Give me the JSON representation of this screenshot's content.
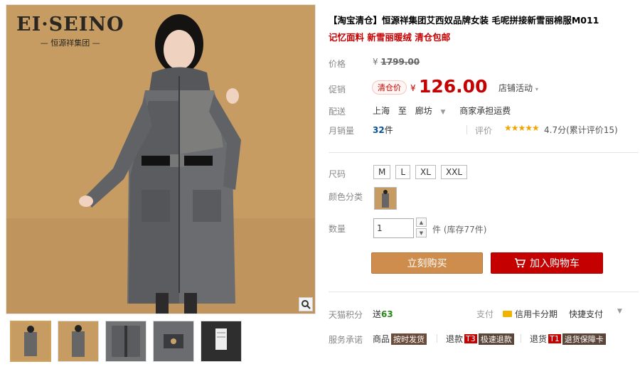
{
  "brand": {
    "name": "EI·SEINO",
    "sub": "— 恒源祥集团 —"
  },
  "title": "【淘宝清仓】恒源祥集团艾西奴品牌女装 毛呢拼接新雪丽棉服M011",
  "subtitle": "记忆面料 新雪丽暖绒 清仓包邮",
  "price": {
    "label": "价格",
    "yen": "¥",
    "value": "1799.00"
  },
  "promo": {
    "label": "促销",
    "tag": "清仓价",
    "yen": "¥",
    "value": "126.00",
    "store_activity": "店铺活动"
  },
  "shipping": {
    "label": "配送",
    "from": "上海",
    "to_word": "至",
    "to": "廊坊",
    "method": "商家承担运费"
  },
  "sales": {
    "label": "月销量",
    "count": "32",
    "unit": "件",
    "rating_label": "评价",
    "stars": "★★★★★",
    "rating": "4.7分(累计评价15)"
  },
  "sizes": {
    "label": "尺码",
    "options": [
      "M",
      "L",
      "XL",
      "XXL"
    ]
  },
  "color": {
    "label": "颜色分类"
  },
  "quantity": {
    "label": "数量",
    "value": "1",
    "stock": "件 (库存77件)"
  },
  "buttons": {
    "buy": "立刻购买",
    "cart": "加入购物车"
  },
  "points": {
    "label": "天猫积分",
    "prefix": "送",
    "value": "63"
  },
  "payment": {
    "label": "支付",
    "credit": "信用卡分期",
    "quick": "快捷支付"
  },
  "service": {
    "label": "服务承诺",
    "goods": "商品",
    "goods_tag": "按时发货",
    "refund": "退款",
    "refund_code": "T3",
    "refund_tag": "极速退款",
    "return": "退货",
    "return_code": "T1",
    "return_tag": "退货保障卡"
  },
  "colors": {
    "accent": "#c40000",
    "buy_button": "#cf8d4d",
    "cart_button": "#c40000",
    "backdrop": "#c69c63",
    "coat": "#6a6c70"
  }
}
